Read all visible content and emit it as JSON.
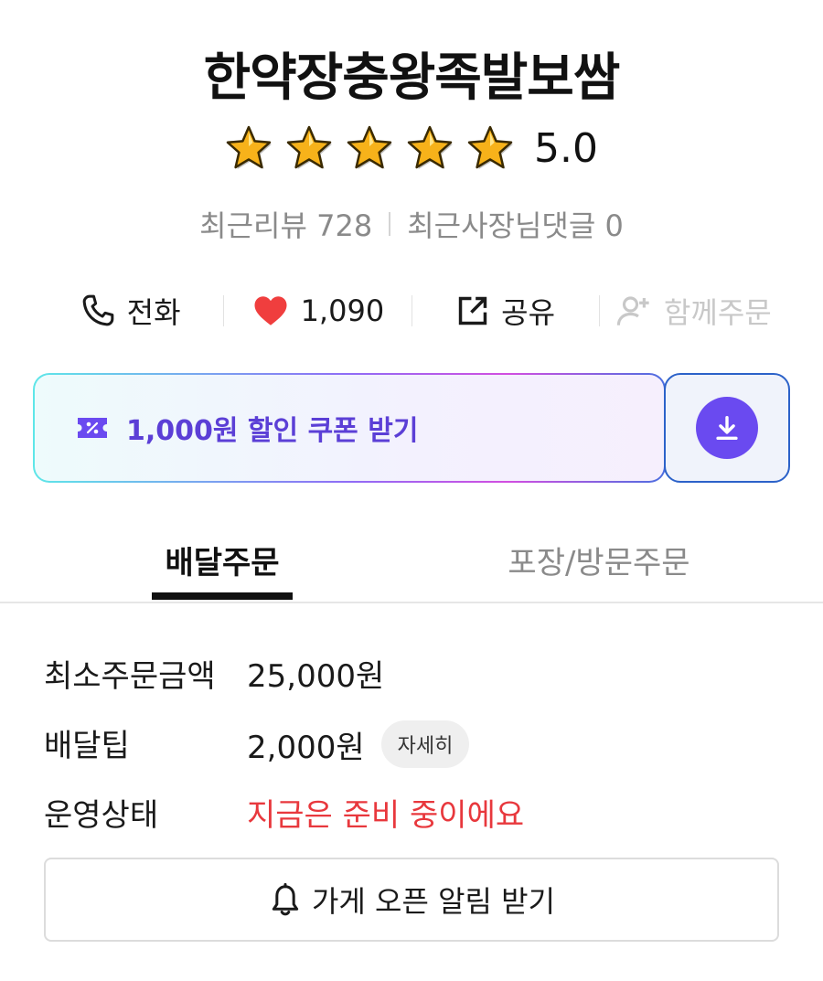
{
  "store": {
    "name": "한약장충왕족발보쌈",
    "rating": {
      "value": "5.0",
      "stars": 5,
      "max": 5
    },
    "recent_reviews_label": "최근리뷰 728",
    "recent_owner_replies_label": "최근사장님댓글 0"
  },
  "actions": {
    "call": {
      "label": "전화",
      "icon": "phone-icon"
    },
    "like": {
      "label": "1,090",
      "icon": "heart-icon",
      "color": "#f03e3e"
    },
    "share": {
      "label": "공유",
      "icon": "share-icon"
    },
    "group_order": {
      "label": "함께주문",
      "icon": "add-person-icon",
      "disabled": true
    }
  },
  "coupon": {
    "label": "1,000원 할인 쿠폰 받기",
    "icon": "coupon-ticket-icon",
    "download_icon": "download-icon",
    "accent": "#6a4af0"
  },
  "tabs": [
    {
      "label": "배달주문",
      "active": true
    },
    {
      "label": "포장/방문주문",
      "active": false
    }
  ],
  "info": {
    "min_order": {
      "label": "최소주문금액",
      "value": "25,000원"
    },
    "delivery_tip": {
      "label": "배달팁",
      "value": "2,000원",
      "detail_label": "자세히"
    },
    "status": {
      "label": "운영상태",
      "value": "지금은 준비 중이에요",
      "color": "#e8383d"
    }
  },
  "open_alert": {
    "label": "가게 오픈 알림 받기",
    "icon": "bell-icon"
  }
}
